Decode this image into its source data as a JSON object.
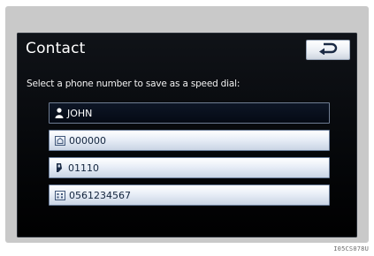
{
  "header": {
    "title": "Contact",
    "back_icon": "back-arrow-icon"
  },
  "instruction": "Select a phone number to save as a speed dial:",
  "contact": {
    "icon": "person-icon",
    "name": "JOHN"
  },
  "numbers": [
    {
      "icon": "phone-home-icon",
      "value": "000000"
    },
    {
      "icon": "phone-mobile-icon",
      "value": "01110"
    },
    {
      "icon": "phone-office-icon",
      "value": "0561234567"
    }
  ],
  "watermark": "I05CS078U",
  "colors": {
    "screen_bg": "#000000",
    "button_bg": "#e9edf3",
    "row_bg": "#e8eef7",
    "text_dark": "#12243d"
  }
}
